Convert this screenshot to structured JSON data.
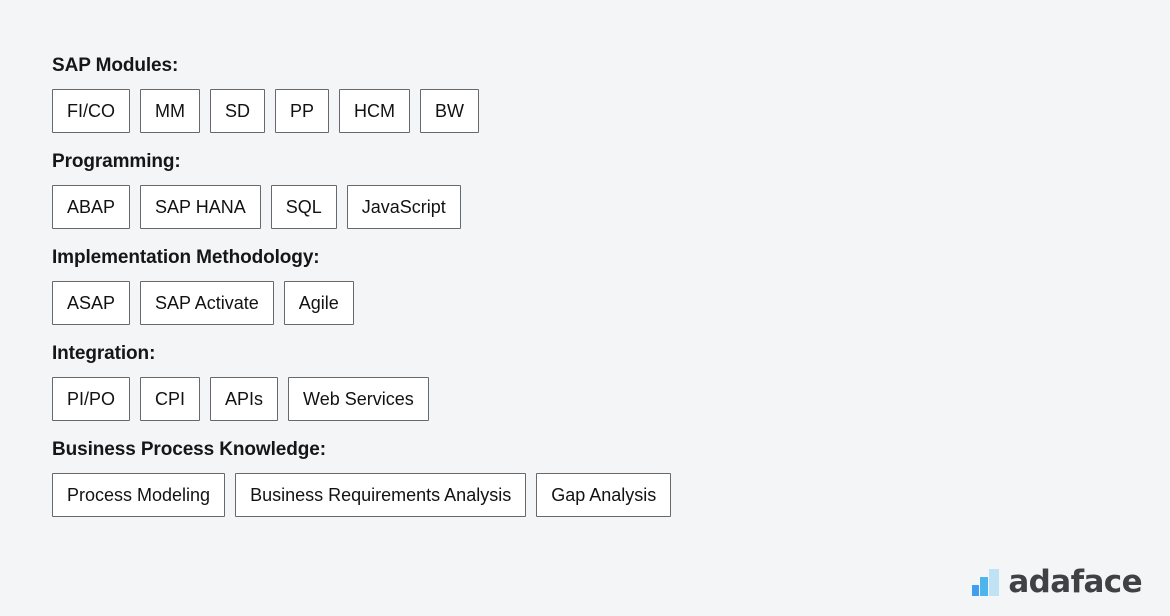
{
  "page": {
    "background_color": "#f4f5f7"
  },
  "skill_groups": [
    {
      "heading": "SAP Modules:",
      "chips": [
        "FI/CO",
        "MM",
        "SD",
        "PP",
        "HCM",
        "BW"
      ]
    },
    {
      "heading": "Programming:",
      "chips": [
        "ABAP",
        "SAP HANA",
        "SQL",
        "JavaScript"
      ]
    },
    {
      "heading": "Implementation Methodology:",
      "chips": [
        "ASAP",
        "SAP Activate",
        "Agile"
      ]
    },
    {
      "heading": "Integration:",
      "chips": [
        "PI/PO",
        "CPI",
        "APIs",
        "Web Services"
      ]
    },
    {
      "heading": "Business Process Knowledge:",
      "chips": [
        "Process Modeling",
        "Business Requirements Analysis",
        "Gap Analysis"
      ]
    }
  ],
  "brand": {
    "name": "adaface",
    "icon": "bar-chart-logo-icon",
    "wordmark_color": "#3f4145",
    "bar_colors": [
      "#3f9ef0",
      "#4db4ec",
      "#bfe2f5"
    ]
  }
}
